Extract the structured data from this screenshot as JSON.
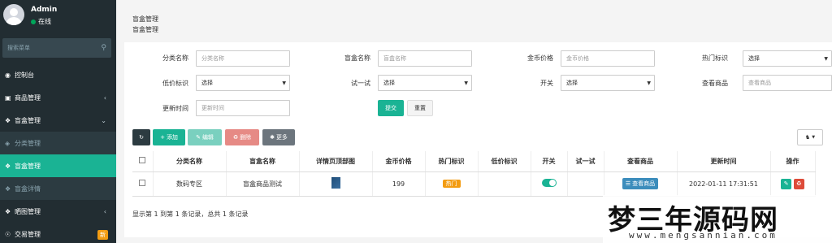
{
  "user": {
    "name": "Admin",
    "status": "在线"
  },
  "sidebar": {
    "search_placeholder": "搜索菜单",
    "items": [
      {
        "label": "控制台",
        "icon": "dashboard-icon"
      },
      {
        "label": "商品管理",
        "icon": "cube-icon"
      },
      {
        "label": "盲盒管理",
        "icon": "gift-icon"
      },
      {
        "label": "分类管理",
        "icon": "tag-icon"
      },
      {
        "label": "盲盒管理",
        "icon": "gift-icon"
      },
      {
        "label": "盲盒详情",
        "icon": "gift-icon"
      },
      {
        "label": "晒图管理",
        "icon": "gift-icon"
      },
      {
        "label": "交易管理",
        "icon": "cart-icon",
        "badge": "新"
      }
    ]
  },
  "header": {
    "title": "盲盒管理",
    "subtitle": "盲盒管理"
  },
  "filters": {
    "category_name": {
      "label": "分类名称",
      "placeholder": "分类名称"
    },
    "box_name": {
      "label": "盲盒名称",
      "placeholder": "盲盒名称"
    },
    "coin_price": {
      "label": "金币价格",
      "placeholder": "金币价格"
    },
    "hot_tag": {
      "label": "热门标识",
      "value": "选择"
    },
    "low_price_tag": {
      "label": "低价标识",
      "value": "选择"
    },
    "try_it": {
      "label": "试一试",
      "value": "选择"
    },
    "switch": {
      "label": "开关",
      "value": "选择"
    },
    "view_goods": {
      "label": "查看商品",
      "placeholder": "查看商品"
    },
    "update_time": {
      "label": "更新时间",
      "placeholder": "更新时间"
    },
    "submit": "提交",
    "reset": "重置"
  },
  "toolbar": {
    "add": "添加",
    "edit": "编辑",
    "delete": "删除",
    "more": "更多"
  },
  "table": {
    "headers": [
      "分类名称",
      "盲盒名称",
      "详情页顶部图",
      "金币价格",
      "热门标识",
      "低价标识",
      "开关",
      "试一试",
      "查看商品",
      "更新时间",
      "操作"
    ],
    "rows": [
      {
        "category": "数码专区",
        "name": "盲盒商品测试",
        "price": "199",
        "hot": "热门",
        "low": "",
        "try": "",
        "view_btn": "查看商品",
        "updated": "2022-01-11 17:31:51"
      }
    ]
  },
  "summary": "显示第 1 到第 1 条记录，总共 1 条记录",
  "watermark": {
    "big": "梦三年源码网",
    "small": "www.mengsannian.com"
  }
}
